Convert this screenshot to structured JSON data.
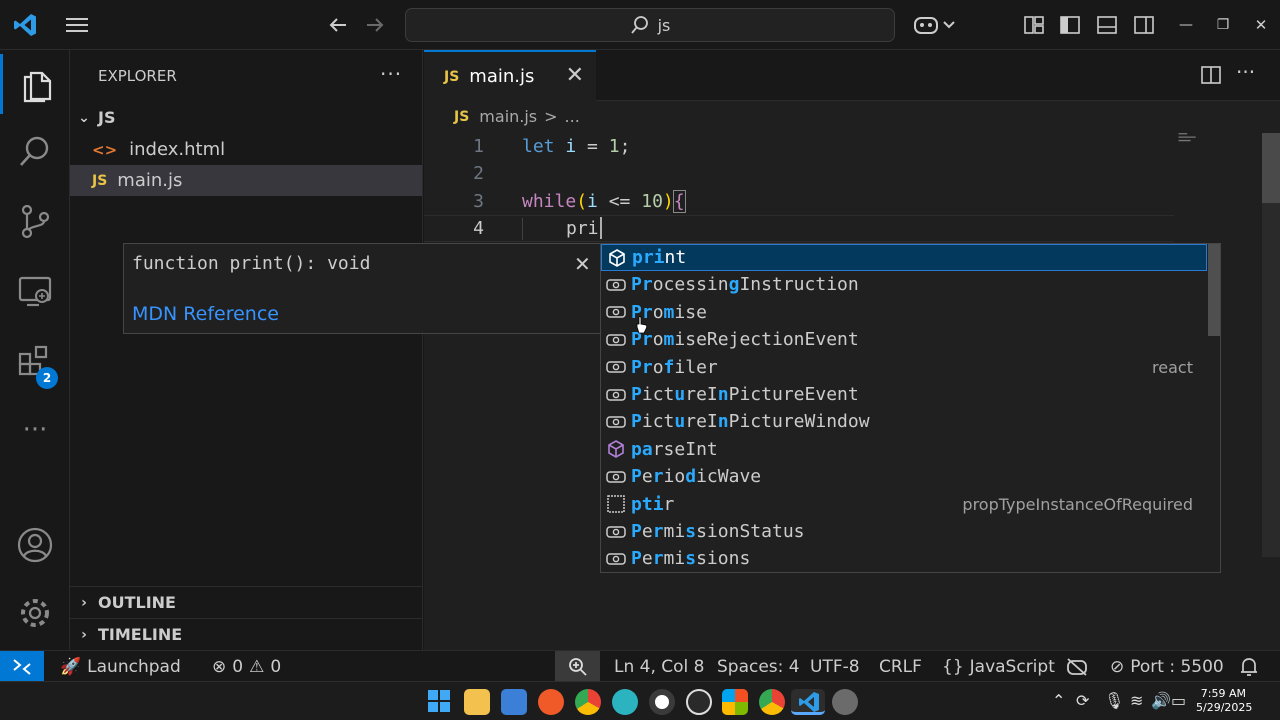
{
  "titlebar": {
    "search_text": "js",
    "nav_back_icon": "arrow-left-icon",
    "nav_forward_icon": "arrow-right-icon",
    "window_minimize": "—",
    "window_restore": "❐",
    "window_close": "✕"
  },
  "activity_bar": {
    "extensions_badge": "2"
  },
  "sidebar": {
    "title": "EXPLORER",
    "more": "···",
    "folder": "JS",
    "files": [
      {
        "icon": "<>",
        "name": "index.html"
      },
      {
        "icon": "JS",
        "name": "main.js"
      }
    ],
    "outline": "OUTLINE",
    "timeline": "TIMELINE"
  },
  "editor": {
    "tab": {
      "icon": "JS",
      "label": "main.js"
    },
    "breadcrumb": {
      "icon": "JS",
      "file": "main.js",
      "sep": ">",
      "rest": "..."
    },
    "lines": [
      {
        "n": "1"
      },
      {
        "n": "2"
      },
      {
        "n": "3"
      },
      {
        "n": "4"
      }
    ],
    "code": {
      "l1_let": "let",
      "l1_i": "i",
      "l1_eq": " = ",
      "l1_num": "1",
      "l1_semi": ";",
      "l3_while": "while",
      "l3_paren": "(",
      "l3_i": "i",
      "l3_op": " <= ",
      "l3_num": "10",
      "l3_close": ")",
      "l3_brace": "{",
      "l4_text": "pri"
    }
  },
  "hover_doc": {
    "signature": "function print(): void",
    "close": "✕",
    "link": "MDN Reference"
  },
  "suggestions": [
    {
      "pre": "",
      "match": "pri",
      "post": "nt",
      "detail": "",
      "icon": "cube-icon"
    },
    {
      "label": "ProcessingInstruction",
      "detail": "",
      "icon": "variable-icon"
    },
    {
      "label": "Promise",
      "detail": "",
      "icon": "variable-icon"
    },
    {
      "label": "PromiseRejectionEvent",
      "detail": "",
      "icon": "variable-icon"
    },
    {
      "label": "Profiler",
      "detail": "react",
      "icon": "variable-icon"
    },
    {
      "label": "PictureInPictureEvent",
      "detail": "",
      "icon": "variable-icon"
    },
    {
      "label": "PictureInPictureWindow",
      "detail": "",
      "icon": "variable-icon"
    },
    {
      "label": "parseInt",
      "detail": "",
      "icon": "cube-icon"
    },
    {
      "label": "PeriodicWave",
      "detail": "",
      "icon": "variable-icon"
    },
    {
      "label": "ptir",
      "detail": "propTypeInstanceOfRequired",
      "icon": "snippet-icon"
    },
    {
      "label": "PermissionStatus",
      "detail": "",
      "icon": "variable-icon"
    },
    {
      "label": "Permissions",
      "detail": "",
      "icon": "variable-icon"
    }
  ],
  "statusbar": {
    "launchpad": "Launchpad",
    "errors": "0",
    "warnings": "0",
    "position": "Ln 4, Col 8",
    "spaces": "Spaces: 4",
    "encoding": "UTF-8",
    "eol": "CRLF",
    "language": "JavaScript",
    "port": "Port : 5500"
  },
  "taskbar": {
    "time": "7:59 AM",
    "date": "5/29/2025"
  },
  "colors": {
    "accent": "#0078d4",
    "match": "#2aaaff",
    "focus_row": "#04395e"
  }
}
